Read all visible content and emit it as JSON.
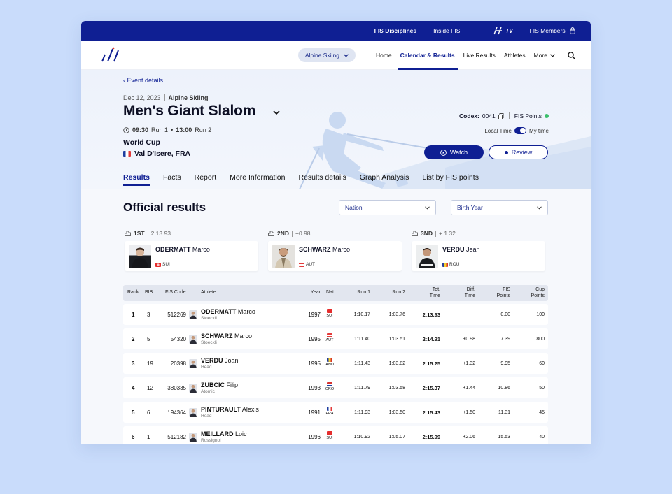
{
  "topbar": {
    "links": [
      "FIS Disciplines",
      "Inside FIS"
    ],
    "tv_label": "TV",
    "members": "FIS Members"
  },
  "nav": {
    "discipline": "Alpine Skiing",
    "items": [
      "Home",
      "Calendar & Results",
      "Live Results",
      "Athletes",
      "More"
    ],
    "active": "Calendar & Results"
  },
  "event": {
    "back": "Event details",
    "date": "Dec 12, 2023",
    "discipline": "Alpine Skiing",
    "title": "Men's Giant Slalom",
    "run1_time": "09:30",
    "run1_label": "Run 1",
    "run2_time": "13:00",
    "run2_label": "Run 2",
    "series": "World Cup",
    "venue": "Val D'Isere, FRA",
    "codex_label": "Codex:",
    "codex_value": "0041",
    "fis_points": "FIS Points",
    "local_time": "Local Time",
    "my_time": "My time",
    "watch": "Watch",
    "review": "Review"
  },
  "tabs": [
    "Results",
    "Facts",
    "Report",
    "More Information",
    "Results details",
    "Graph Analysis",
    "List by FIS points"
  ],
  "results": {
    "title": "Official results",
    "filter_nation": "Nation",
    "filter_birth": "Birth Year"
  },
  "podium": [
    {
      "place": "1ST",
      "gap": "2:13.93",
      "last": "ODERMATT",
      "first": "Marco",
      "nat": "SUI"
    },
    {
      "place": "2ND",
      "gap": "+0.98",
      "last": "SCHWARZ",
      "first": "Marco",
      "nat": "AUT"
    },
    {
      "place": "3ND",
      "gap": "+ 1.32",
      "last": "VERDU",
      "first": "Jean",
      "nat": "ROU"
    }
  ],
  "table": {
    "headers": {
      "rank": "Rank",
      "bib": "BIB",
      "fis_code": "FIS Code",
      "athlete": "Athlete",
      "year": "Year",
      "nat": "Nat",
      "run1": "Run 1",
      "run2": "Run 2",
      "tot_a": "Tot.",
      "tot_b": "Time",
      "diff_a": "Diff.",
      "diff_b": "Time",
      "fisp_a": "FIS",
      "fisp_b": "Points",
      "cup_a": "Cup",
      "cup_b": "Points"
    },
    "rows": [
      {
        "rank": "1",
        "bib": "3",
        "code": "512269",
        "last": "ODERMATT",
        "first": "Marco",
        "brand": "Stoeckli",
        "year": "1997",
        "nat": "SUI",
        "run1": "1:10.17",
        "run2": "1:03.76",
        "tot": "2:13.93",
        "diff": "",
        "fisp": "0.00",
        "cup": "100"
      },
      {
        "rank": "2",
        "bib": "5",
        "code": "54320",
        "last": "SCHWARZ",
        "first": "Marco",
        "brand": "Stoeckli",
        "year": "1995",
        "nat": "AUT",
        "run1": "1:11.40",
        "run2": "1:03.51",
        "tot": "2:14.91",
        "diff": "+0.98",
        "fisp": "7.39",
        "cup": "800"
      },
      {
        "rank": "3",
        "bib": "19",
        "code": "20398",
        "last": "VERDU",
        "first": "Joan",
        "brand": "Head",
        "year": "1995",
        "nat": "AND",
        "run1": "1:11.43",
        "run2": "1:03.82",
        "tot": "2:15.25",
        "diff": "+1.32",
        "fisp": "9.95",
        "cup": "60"
      },
      {
        "rank": "4",
        "bib": "12",
        "code": "380335",
        "last": "ZUBCIC",
        "first": "Filip",
        "brand": "Atomic",
        "year": "1993",
        "nat": "CRO",
        "run1": "1:11.79",
        "run2": "1:03.58",
        "tot": "2:15.37",
        "diff": "+1.44",
        "fisp": "10.86",
        "cup": "50"
      },
      {
        "rank": "5",
        "bib": "6",
        "code": "194364",
        "last": "PINTURAULT",
        "first": "Alexis",
        "brand": "Head",
        "year": "1991",
        "nat": "FRA",
        "run1": "1:11.93",
        "run2": "1:03.50",
        "tot": "2:15.43",
        "diff": "+1.50",
        "fisp": "11.31",
        "cup": "45"
      },
      {
        "rank": "6",
        "bib": "1",
        "code": "512182",
        "last": "MEILLARD",
        "first": "Loic",
        "brand": "Rossignol",
        "year": "1996",
        "nat": "SUI",
        "run1": "1:10.92",
        "run2": "1:05.07",
        "tot": "2:15.99",
        "diff": "+2.06",
        "fisp": "15.53",
        "cup": "40"
      }
    ]
  },
  "colors": {
    "brand_blue": "#0f1f93",
    "background": "#c9dcfb",
    "fis_points_dot": "#3bbf6b"
  }
}
